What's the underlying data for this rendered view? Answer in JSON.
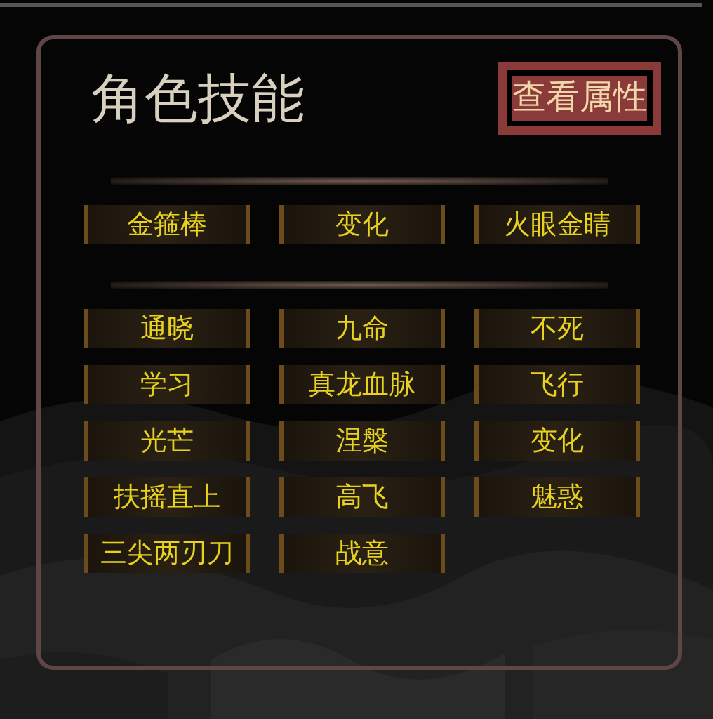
{
  "title": "角色技能",
  "button": {
    "label": "查看属性"
  },
  "sections": [
    {
      "skills": [
        "金箍棒",
        "变化",
        "火眼金睛"
      ]
    },
    {
      "skills": [
        "通晓",
        "九命",
        "不死",
        "学习",
        "真龙血脉",
        "飞行",
        "光芒",
        "涅槃",
        "变化",
        "扶摇直上",
        "高飞",
        "魅惑",
        "三尖两刃刀",
        "战意"
      ]
    }
  ]
}
